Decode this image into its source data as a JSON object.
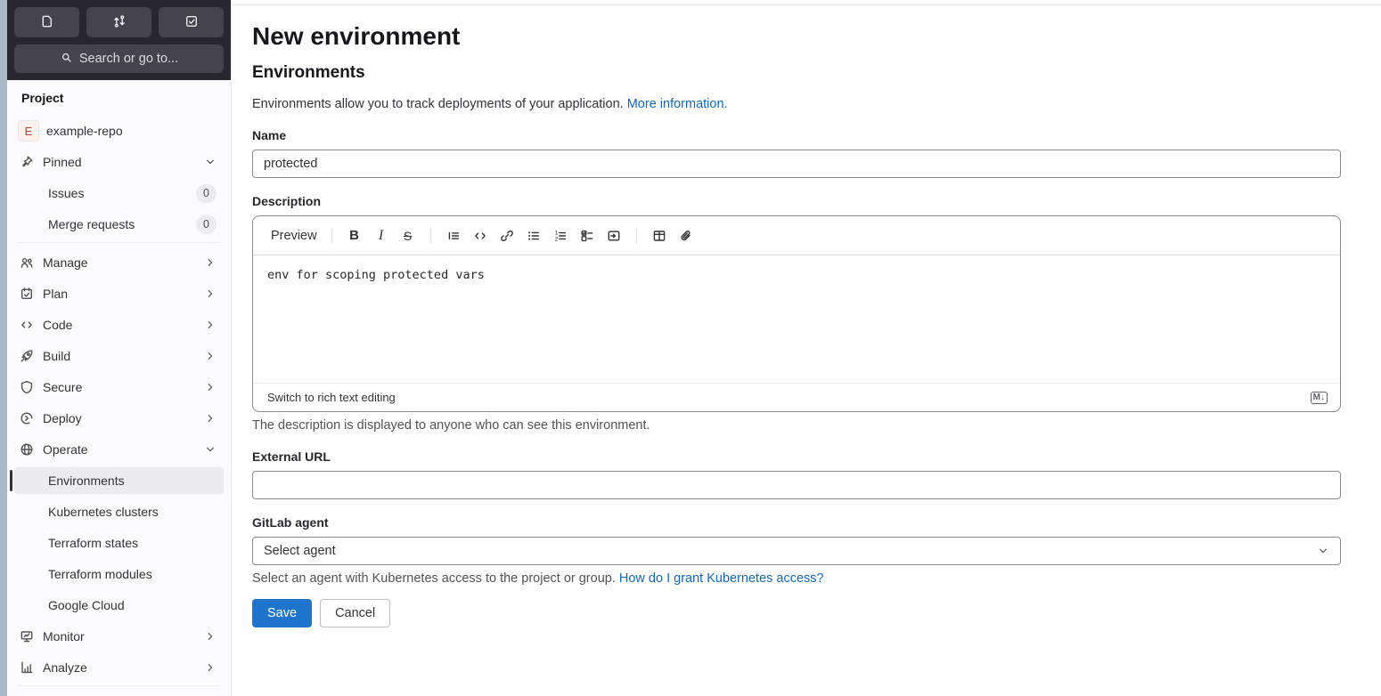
{
  "colors": {
    "accent_blue": "#1f75cb",
    "link_blue": "#1068bf",
    "sidebar_dark": "#28262e",
    "sidebar_bg": "#fbfafd",
    "selected_bg": "#ececef",
    "avatar_bg": "#fdf1ee",
    "avatar_text": "#c24328",
    "left_strip": "#a8b7c6"
  },
  "topbar": {
    "search_label": "Search or go to...",
    "shortcuts": [
      "issues",
      "merge-requests",
      "todo-list"
    ]
  },
  "sidebar": {
    "section_label": "Project",
    "project": {
      "avatar_letter": "E",
      "name": "example-repo"
    },
    "pinned": {
      "label": "Pinned",
      "items": [
        {
          "label": "Issues",
          "badge": "0"
        },
        {
          "label": "Merge requests",
          "badge": "0"
        }
      ]
    },
    "nav": [
      {
        "label": "Manage"
      },
      {
        "label": "Plan"
      },
      {
        "label": "Code"
      },
      {
        "label": "Build"
      },
      {
        "label": "Secure"
      },
      {
        "label": "Deploy"
      },
      {
        "label": "Operate"
      }
    ],
    "operate_items": [
      {
        "label": "Environments",
        "selected": true
      },
      {
        "label": "Kubernetes clusters"
      },
      {
        "label": "Terraform states"
      },
      {
        "label": "Terraform modules"
      },
      {
        "label": "Google Cloud"
      }
    ],
    "nav_bottom": [
      {
        "label": "Monitor"
      },
      {
        "label": "Analyze"
      }
    ]
  },
  "main": {
    "title": "New environment",
    "heading": "Environments",
    "intro": {
      "text": "Environments allow you to track deployments of your application.",
      "link": "More information."
    },
    "name": {
      "label": "Name",
      "value": "protected"
    },
    "description": {
      "label": "Description",
      "preview_label": "Preview",
      "value": "env for scoping protected vars",
      "switch_label": "Switch to rich text editing",
      "help": "The description is displayed to anyone who can see this environment."
    },
    "external_url": {
      "label": "External URL",
      "value": ""
    },
    "agent": {
      "label": "GitLab agent",
      "value": "Select agent",
      "help": "Select an agent with Kubernetes access to the project or group.",
      "help_link": "How do I grant Kubernetes access?"
    },
    "actions": {
      "save": "Save",
      "cancel": "Cancel"
    }
  },
  "icons": {
    "bold_glyph": "B",
    "italic_glyph": "I",
    "strike_glyph": "S",
    "markdown_badge": "M↓",
    "ordered_list_numbers": [
      "1",
      "2"
    ]
  }
}
